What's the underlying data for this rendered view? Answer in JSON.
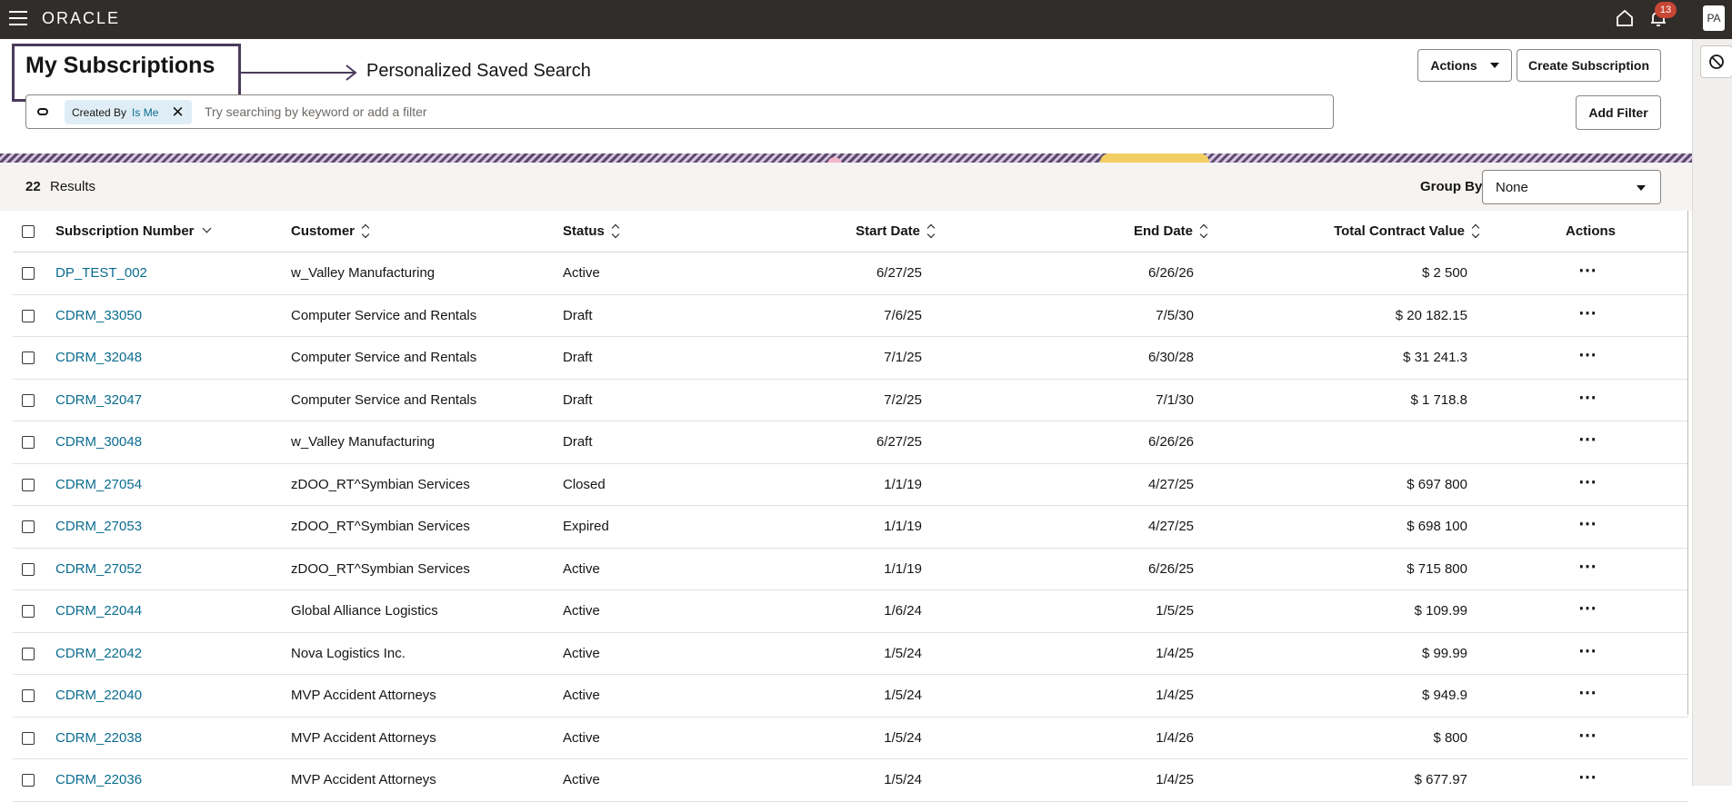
{
  "app": {
    "logo": "ORACLE",
    "notifications_count": "13",
    "avatar_initials": "PA",
    "icons": [
      "hamburger-icon",
      "home-icon",
      "bell-icon",
      "block-icon"
    ]
  },
  "header": {
    "title": "My Subscriptions",
    "annotation": "Personalized Saved Search",
    "actions_label": "Actions",
    "create_label": "Create Subscription"
  },
  "search": {
    "chip_key": "Created By",
    "chip_value": "Is Me",
    "placeholder": "Try searching by keyword or add a filter",
    "add_filter_label": "Add Filter"
  },
  "results": {
    "count": "22",
    "label": "Results",
    "group_by_label": "Group By",
    "group_by_value": "None"
  },
  "table": {
    "columns": {
      "number": "Subscription Number",
      "customer": "Customer",
      "status": "Status",
      "start": "Start Date",
      "end": "End Date",
      "value": "Total Contract Value",
      "actions": "Actions"
    },
    "actions_glyph": "⋯",
    "rows": [
      {
        "number": "DP_TEST_002",
        "customer": "w_Valley Manufacturing",
        "status": "Active",
        "start": "6/27/25",
        "end": "6/26/26",
        "value": "$ 2 500"
      },
      {
        "number": "CDRM_33050",
        "customer": "Computer Service and Rentals",
        "status": "Draft",
        "start": "7/6/25",
        "end": "7/5/30",
        "value": "$ 20 182.15"
      },
      {
        "number": "CDRM_32048",
        "customer": "Computer Service and Rentals",
        "status": "Draft",
        "start": "7/1/25",
        "end": "6/30/28",
        "value": "$ 31 241.3"
      },
      {
        "number": "CDRM_32047",
        "customer": "Computer Service and Rentals",
        "status": "Draft",
        "start": "7/2/25",
        "end": "7/1/30",
        "value": "$ 1 718.8"
      },
      {
        "number": "CDRM_30048",
        "customer": "w_Valley Manufacturing",
        "status": "Draft",
        "start": "6/27/25",
        "end": "6/26/26",
        "value": ""
      },
      {
        "number": "CDRM_27054",
        "customer": "zDOO_RT^Symbian Services",
        "status": "Closed",
        "start": "1/1/19",
        "end": "4/27/25",
        "value": "$ 697 800"
      },
      {
        "number": "CDRM_27053",
        "customer": "zDOO_RT^Symbian Services",
        "status": "Expired",
        "start": "1/1/19",
        "end": "4/27/25",
        "value": "$ 698 100"
      },
      {
        "number": "CDRM_27052",
        "customer": "zDOO_RT^Symbian Services",
        "status": "Active",
        "start": "1/1/19",
        "end": "6/26/25",
        "value": "$ 715 800"
      },
      {
        "number": "CDRM_22044",
        "customer": "Global Alliance Logistics",
        "status": "Active",
        "start": "1/6/24",
        "end": "1/5/25",
        "value": "$ 109.99"
      },
      {
        "number": "CDRM_22042",
        "customer": "Nova Logistics Inc.",
        "status": "Active",
        "start": "1/5/24",
        "end": "1/4/25",
        "value": "$ 99.99"
      },
      {
        "number": "CDRM_22040",
        "customer": "MVP Accident Attorneys",
        "status": "Active",
        "start": "1/5/24",
        "end": "1/4/25",
        "value": "$ 949.9"
      },
      {
        "number": "CDRM_22038",
        "customer": "MVP Accident Attorneys",
        "status": "Active",
        "start": "1/5/24",
        "end": "1/4/26",
        "value": "$ 800"
      },
      {
        "number": "CDRM_22036",
        "customer": "MVP Accident Attorneys",
        "status": "Active",
        "start": "1/5/24",
        "end": "1/4/25",
        "value": "$ 677.97"
      }
    ]
  }
}
